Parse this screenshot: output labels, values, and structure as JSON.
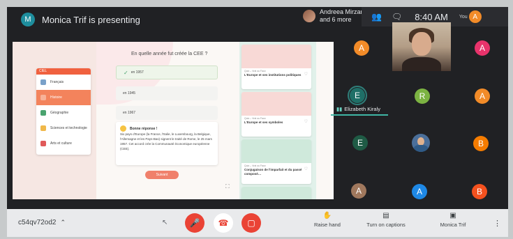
{
  "header": {
    "presenter_initial": "M",
    "presenting_text": "Monica Trif is presenting",
    "participants_name": "Andreea Mirzan",
    "participants_more": "and 6 more",
    "people_icon": "people-icon",
    "chat_icon": "chat-icon",
    "time": "8:40 AM",
    "you_label": "You",
    "you_initial": "A"
  },
  "slide": {
    "question": "En quelle année fut créée la CEE ?",
    "menu_header": "CIEL",
    "menu_items": [
      {
        "label": "Français",
        "color": "#7aa1c9"
      },
      {
        "label": "Histoire",
        "color": "#f7b298"
      },
      {
        "label": "Géographie",
        "color": "#4aa36f"
      },
      {
        "label": "Sciences et technologie",
        "color": "#f0b84a"
      },
      {
        "label": "Arts et culture",
        "color": "#e05a5a"
      }
    ],
    "options": [
      "en 1957",
      "en 1945",
      "en 1967"
    ],
    "answer_title": "Bonne réponse !",
    "answer_text": "Six pays d'Europe (la France, l'Italie, le Luxembourg, la Belgique, l'Allemagne et les Pays-Bas) signent le traité de Rome, le 25 mars 1957. Cet accord crée la Communauté économique européenne (CEE).",
    "start_button": "Suivant",
    "cards": [
      {
        "small": "Quiz – Vrai ou Faux",
        "title": "L'Europe et ses institutions politiques",
        "color": "#f8d9d6"
      },
      {
        "small": "Quiz – Vrai ou Faux",
        "title": "L'Europe et ses symboles",
        "color": "#f8d9d6"
      },
      {
        "small": "Quiz – Vrai ou Faux",
        "title": "Conjugaison de l'imparfait et du passé composé…",
        "color": "#cfe9db"
      },
      {
        "small": "",
        "title": "",
        "color": "#cfe9db"
      }
    ]
  },
  "participants": {
    "tiles": [
      {
        "initial": "A",
        "color": "#f28b28"
      },
      {
        "initial": "A",
        "color": "#e8336b"
      },
      {
        "initial": "E",
        "color": "#1f6f67"
      },
      {
        "initial": "R",
        "color": "#7cb342"
      },
      {
        "initial": "A",
        "color": "#f28b28"
      },
      {
        "initial": "E",
        "color": "#1f5b45"
      },
      {
        "initial": "B",
        "color": "#f57c00"
      },
      {
        "initial": "A",
        "color": "#a0785d"
      },
      {
        "initial": "A",
        "color": "#1e88e5"
      },
      {
        "initial": "B",
        "color": "#f4511e"
      }
    ],
    "speaking_name": "Elizabeth Kiraly"
  },
  "bottombar": {
    "meeting_code": "c54qv72od2",
    "mic_icon": "mic-off-icon",
    "hangup_icon": "hangup-icon",
    "camera_icon": "camera-off-icon",
    "raise_hand": "Raise hand",
    "captions": "Turn on captions",
    "presenter": "Monica Trif"
  }
}
